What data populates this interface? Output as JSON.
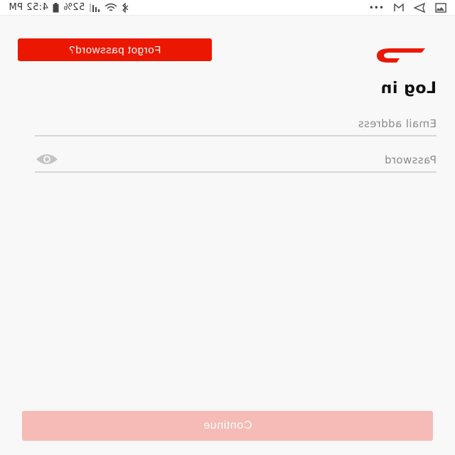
{
  "status_bar": {
    "time": "4:52 PM",
    "battery": "52%",
    "icons": [
      "gallery-icon",
      "send-icon",
      "gmail-icon",
      "more-dots-icon",
      "bluetooth-icon",
      "wifi-icon",
      "signal-icon",
      "battery-icon"
    ],
    "more_dots": "•••"
  },
  "header": {
    "logo": "doordash-logo",
    "forgot_label": "Forgot password?"
  },
  "form": {
    "title": "Log in",
    "email_placeholder": "Email address",
    "password_placeholder": "Password",
    "show_password_icon": "eye-icon",
    "continue_label": "Continue"
  },
  "colors": {
    "brand_red": "#eb1700",
    "continue_disabled": "#f6bbb6",
    "background": "#f8f8f8",
    "divider": "#d6d6d6"
  }
}
